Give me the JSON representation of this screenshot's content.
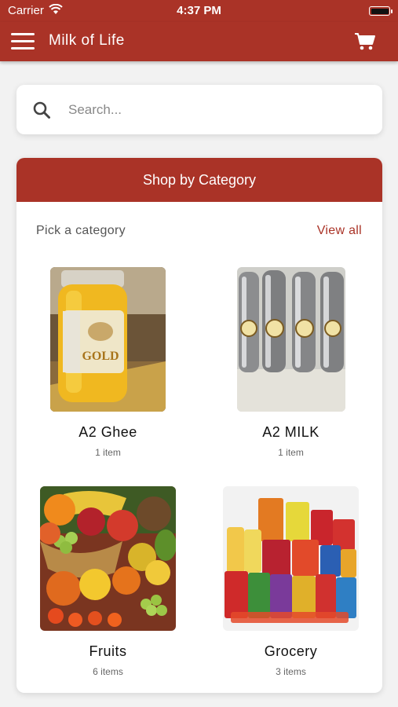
{
  "status_bar": {
    "carrier": "Carrier",
    "time": "4:37 PM"
  },
  "app_bar": {
    "title": "Milk of Life"
  },
  "search": {
    "placeholder": "Search..."
  },
  "category_section": {
    "header": "Shop by Category",
    "subtitle": "Pick a category",
    "view_all": "View all",
    "items": [
      {
        "name": "A2 Ghee",
        "count": "1 item",
        "image": "ghee-jar-photo"
      },
      {
        "name": "A2 MILK",
        "count": "1 item",
        "image": "steel-bottles-photo"
      },
      {
        "name": "Fruits",
        "count": "6 items",
        "image": "fruit-basket-photo"
      },
      {
        "name": "Grocery",
        "count": "3 items",
        "image": "grocery-products-photo"
      }
    ]
  },
  "colors": {
    "brand": "#aa3327",
    "background": "#f2f2f2"
  }
}
